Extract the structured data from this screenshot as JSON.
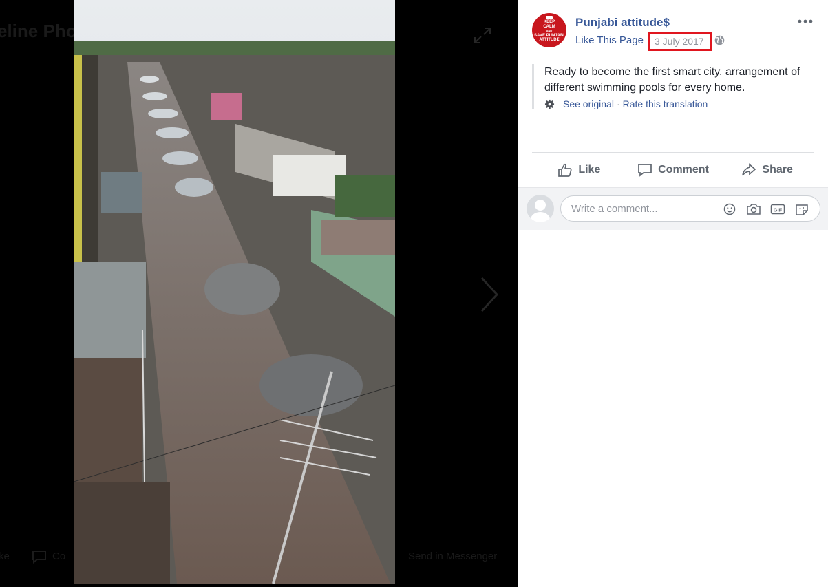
{
  "viewer": {
    "album_title": "eline Pho",
    "bottom_like": "ke",
    "bottom_comment": "Co",
    "bottom_send": "Send in Messenger"
  },
  "post": {
    "page_name": "Punjabi attitude$",
    "like_page_label": "Like This Page",
    "timestamp": "3 July 2017",
    "privacy_icon": "globe-icon",
    "avatar_text": [
      "KEEP",
      "CALM",
      "AND",
      "SAVE PUNJABI",
      "ATTITUDE"
    ],
    "text": "Ready to become the first smart city, arrangement of different swimming pools for every home.",
    "see_original": "See original",
    "rate_translation": "Rate this translation"
  },
  "actions": {
    "like": "Like",
    "comment": "Comment",
    "share": "Share"
  },
  "comment_box": {
    "placeholder": "Write a comment...",
    "icons": [
      "emoji-icon",
      "camera-icon",
      "gif-icon",
      "sticker-icon"
    ]
  },
  "colors": {
    "link": "#385898",
    "highlight_box": "#e0161f",
    "avatar_bg": "#c8161d"
  }
}
